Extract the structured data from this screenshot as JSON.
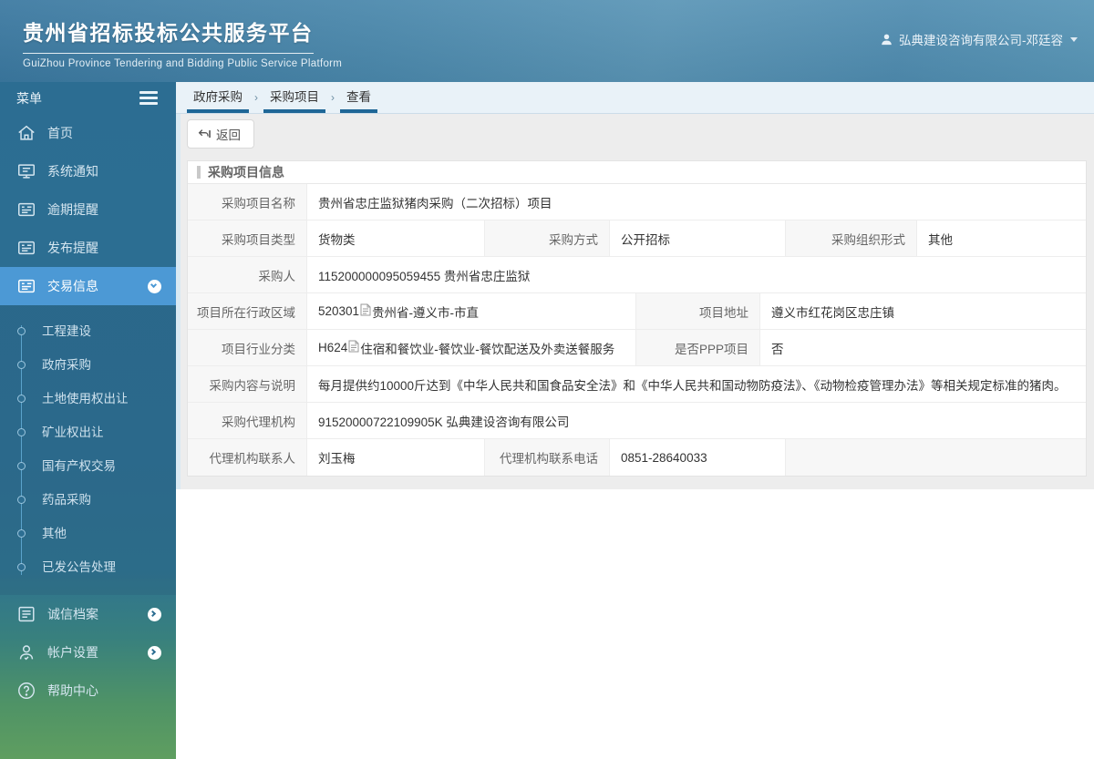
{
  "header": {
    "title": "贵州省招标投标公共服务平台",
    "subtitle": "GuiZhou Province Tendering and Bidding Public Service Platform",
    "user": "弘典建设咨询有限公司-邓廷容"
  },
  "sidebar": {
    "menu_label": "菜单",
    "items": [
      {
        "label": "首页",
        "icon": "home-icon"
      },
      {
        "label": "系统通知",
        "icon": "monitor-icon"
      },
      {
        "label": "逾期提醒",
        "icon": "card-icon"
      },
      {
        "label": "发布提醒",
        "icon": "card-icon"
      },
      {
        "label": "交易信息",
        "icon": "card-icon",
        "active": true
      }
    ],
    "submenu": [
      "工程建设",
      "政府采购",
      "土地使用权出让",
      "矿业权出让",
      "国有产权交易",
      "药品采购",
      "其他",
      "已发公告处理"
    ],
    "bottom": [
      {
        "label": "诚信档案",
        "icon": "card-icon",
        "chevron": "right"
      },
      {
        "label": "帐户设置",
        "icon": "person-icon",
        "chevron": "right"
      },
      {
        "label": "帮助中心",
        "icon": "question-icon"
      }
    ]
  },
  "breadcrumb": {
    "items": [
      "政府采购",
      "采购项目",
      "查看"
    ],
    "separator": "›"
  },
  "toolbar": {
    "back": "返回"
  },
  "panel": {
    "title": "采购项目信息",
    "rows": {
      "name": {
        "label": "采购项目名称",
        "value": "贵州省忠庄监狱猪肉采购（二次招标）项目"
      },
      "type": {
        "label": "采购项目类型",
        "value": "货物类"
      },
      "method": {
        "label": "采购方式",
        "value": "公开招标"
      },
      "org_form": {
        "label": "采购组织形式",
        "value": "其他"
      },
      "purchaser": {
        "label": "采购人",
        "value": "115200000095059455 贵州省忠庄监狱"
      },
      "region": {
        "label": "项目所在行政区域",
        "code": "520301",
        "value": "贵州省-遵义市-市直"
      },
      "address": {
        "label": "项目地址",
        "value": "遵义市红花岗区忠庄镇"
      },
      "industry": {
        "label": "项目行业分类",
        "code": "H624",
        "value": "住宿和餐饮业-餐饮业-餐饮配送及外卖送餐服务"
      },
      "ppp": {
        "label": "是否PPP项目",
        "value": "否"
      },
      "content": {
        "label": "采购内容与说明",
        "value": "每月提供约10000斤达到《中华人民共和国食品安全法》和《中华人民共和国动物防疫法》、《动物检疫管理办法》等相关规定标准的猪肉。"
      },
      "agency": {
        "label": "采购代理机构",
        "value": "91520000722109905K 弘典建设咨询有限公司"
      },
      "contact": {
        "label": "代理机构联系人",
        "value": "刘玉梅"
      },
      "phone": {
        "label": "代理机构联系电话",
        "value": "0851-28640033"
      }
    }
  },
  "colors": {
    "accent": "#4c99d5",
    "sidebar": "#2d6e92",
    "breadcrumb_bar": "#1f6797",
    "header_blue": "#4a88ac"
  }
}
